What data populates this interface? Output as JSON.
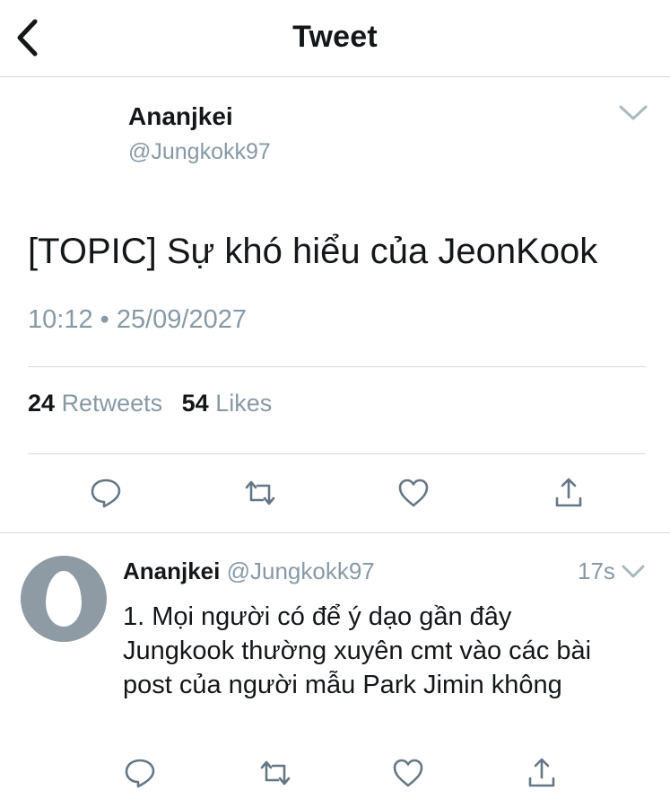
{
  "header": {
    "title": "Tweet",
    "back_icon": "chevron-left-icon"
  },
  "tweet": {
    "author_name": "Ananjkei",
    "author_handle": "@Jungkokk97",
    "text": "[TOPIC] Sự khó hiểu của JeonKook",
    "time": "10:12 • 25/09/2027",
    "stats": {
      "retweets_count": "24",
      "retweets_label": "Retweets",
      "likes_count": "54",
      "likes_label": "Likes"
    },
    "actions": [
      "reply-icon",
      "retweet-icon",
      "like-icon",
      "share-icon"
    ]
  },
  "reply": {
    "author_name": "Ananjkei",
    "author_handle": "@Jungkokk97",
    "time": "17s",
    "text": "1. Mọi người có để ý dạo gần đây Jungkook thường xuyên cmt vào các bài post của người mẫu Park Jimin không",
    "actions": [
      "reply-icon",
      "retweet-icon",
      "like-icon",
      "share-icon"
    ]
  },
  "colors": {
    "text_primary": "#14171a",
    "text_secondary": "#8899a6",
    "divider": "#d6d9dc",
    "avatar_bg": "#8e9aa4"
  }
}
